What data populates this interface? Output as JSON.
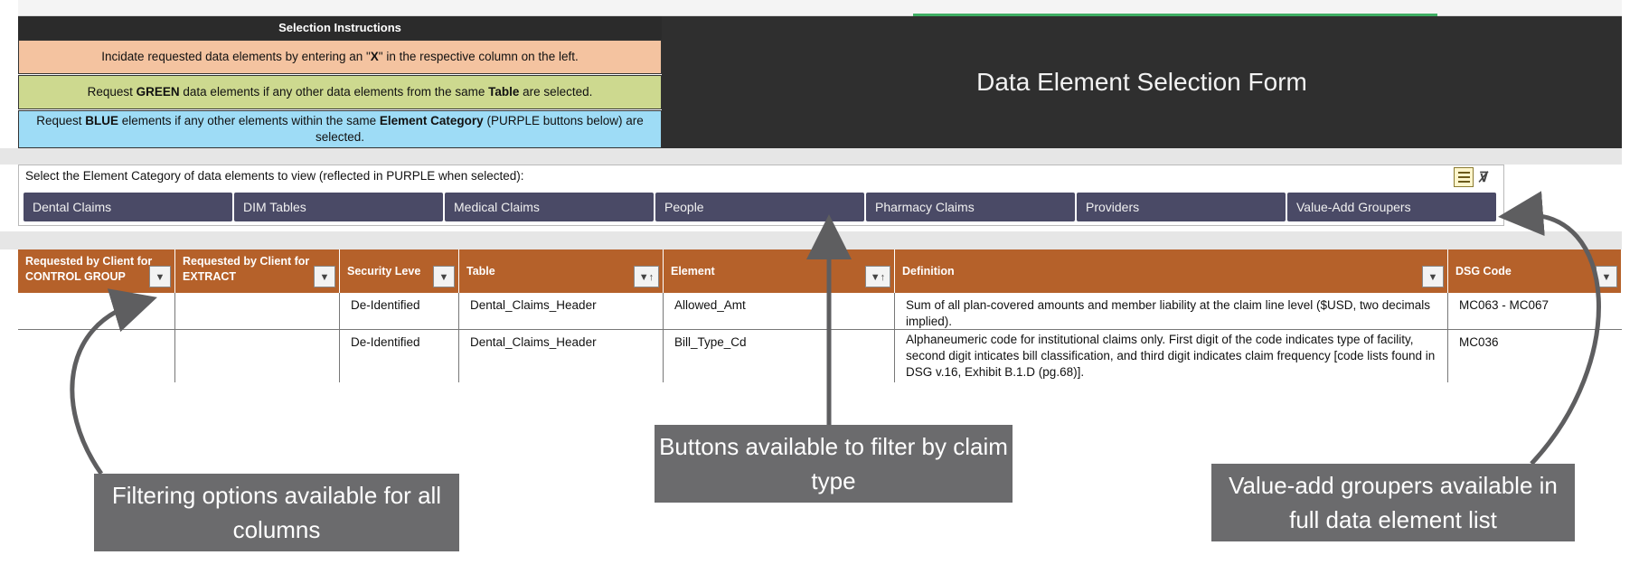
{
  "instructions": {
    "title": "Selection Instructions",
    "line1_pre": "Incidate requested data elements by entering an \"",
    "line1_bold": "X",
    "line1_post": "\" in the respective column on the left.",
    "line2_pre": "Request ",
    "line2_bold1": "GREEN",
    "line2_mid": " data elements if any other data elements from the same ",
    "line2_bold2": "Table",
    "line2_post": " are selected.",
    "line3_pre": "Request ",
    "line3_bold1": "BLUE",
    "line3_mid": " elements if any other elements within the same ",
    "line3_bold2": "Element Category",
    "line3_post": " (PURPLE buttons below) are selected."
  },
  "form_title": "Data Element Selection Form",
  "category": {
    "prompt": "Select the Element Category of data elements to view (reflected in PURPLE when selected):",
    "buttons": [
      "Dental Claims",
      "DIM Tables",
      "Medical Claims",
      "People",
      "Pharmacy Claims",
      "Providers",
      "Value-Add Groupers"
    ]
  },
  "table": {
    "headers": [
      {
        "line1": "Requested by Client for",
        "line2": "CONTROL GROUP"
      },
      {
        "line1": "Requested by Client for",
        "line2": "EXTRACT"
      },
      {
        "line1": "Security Leve",
        "line2": ""
      },
      {
        "line1": "Table",
        "line2": ""
      },
      {
        "line1": "Element",
        "line2": ""
      },
      {
        "line1": "Definition",
        "line2": ""
      },
      {
        "line1": "DSG Code",
        "line2": ""
      }
    ],
    "rows": [
      {
        "control": "",
        "extract": "",
        "security": "De-Identified",
        "table": "Dental_Claims_Header",
        "element": "Allowed_Amt",
        "definition": "Sum of all plan-covered amounts and member liability at the claim line level ($USD, two decimals implied).",
        "dsg": "MC063 - MC067"
      },
      {
        "control": "",
        "extract": "",
        "security": "De-Identified",
        "table": "Dental_Claims_Header",
        "element": "Bill_Type_Cd",
        "definition": "Alphaneumeric code for institutional claims only. First digit of the code indicates type of facility, second digit inticates bill classification, and third digit indicates claim frequency [code lists found in DSG v.16, Exhibit B.1.D (pg.68)].",
        "dsg": "MC036"
      }
    ]
  },
  "callouts": {
    "filter": "Filtering options available for all columns",
    "buttons": "Buttons available to filter by claim type",
    "groupers": "Value-add groupers available in full data element list"
  },
  "colors": {
    "header_orange": "#b5612a",
    "category_button": "#4a4a66",
    "instr_orange": "#f4c3a0",
    "instr_green": "#cdd98f",
    "instr_blue": "#9edcf6",
    "callout_gray": "#6b6b6d"
  }
}
